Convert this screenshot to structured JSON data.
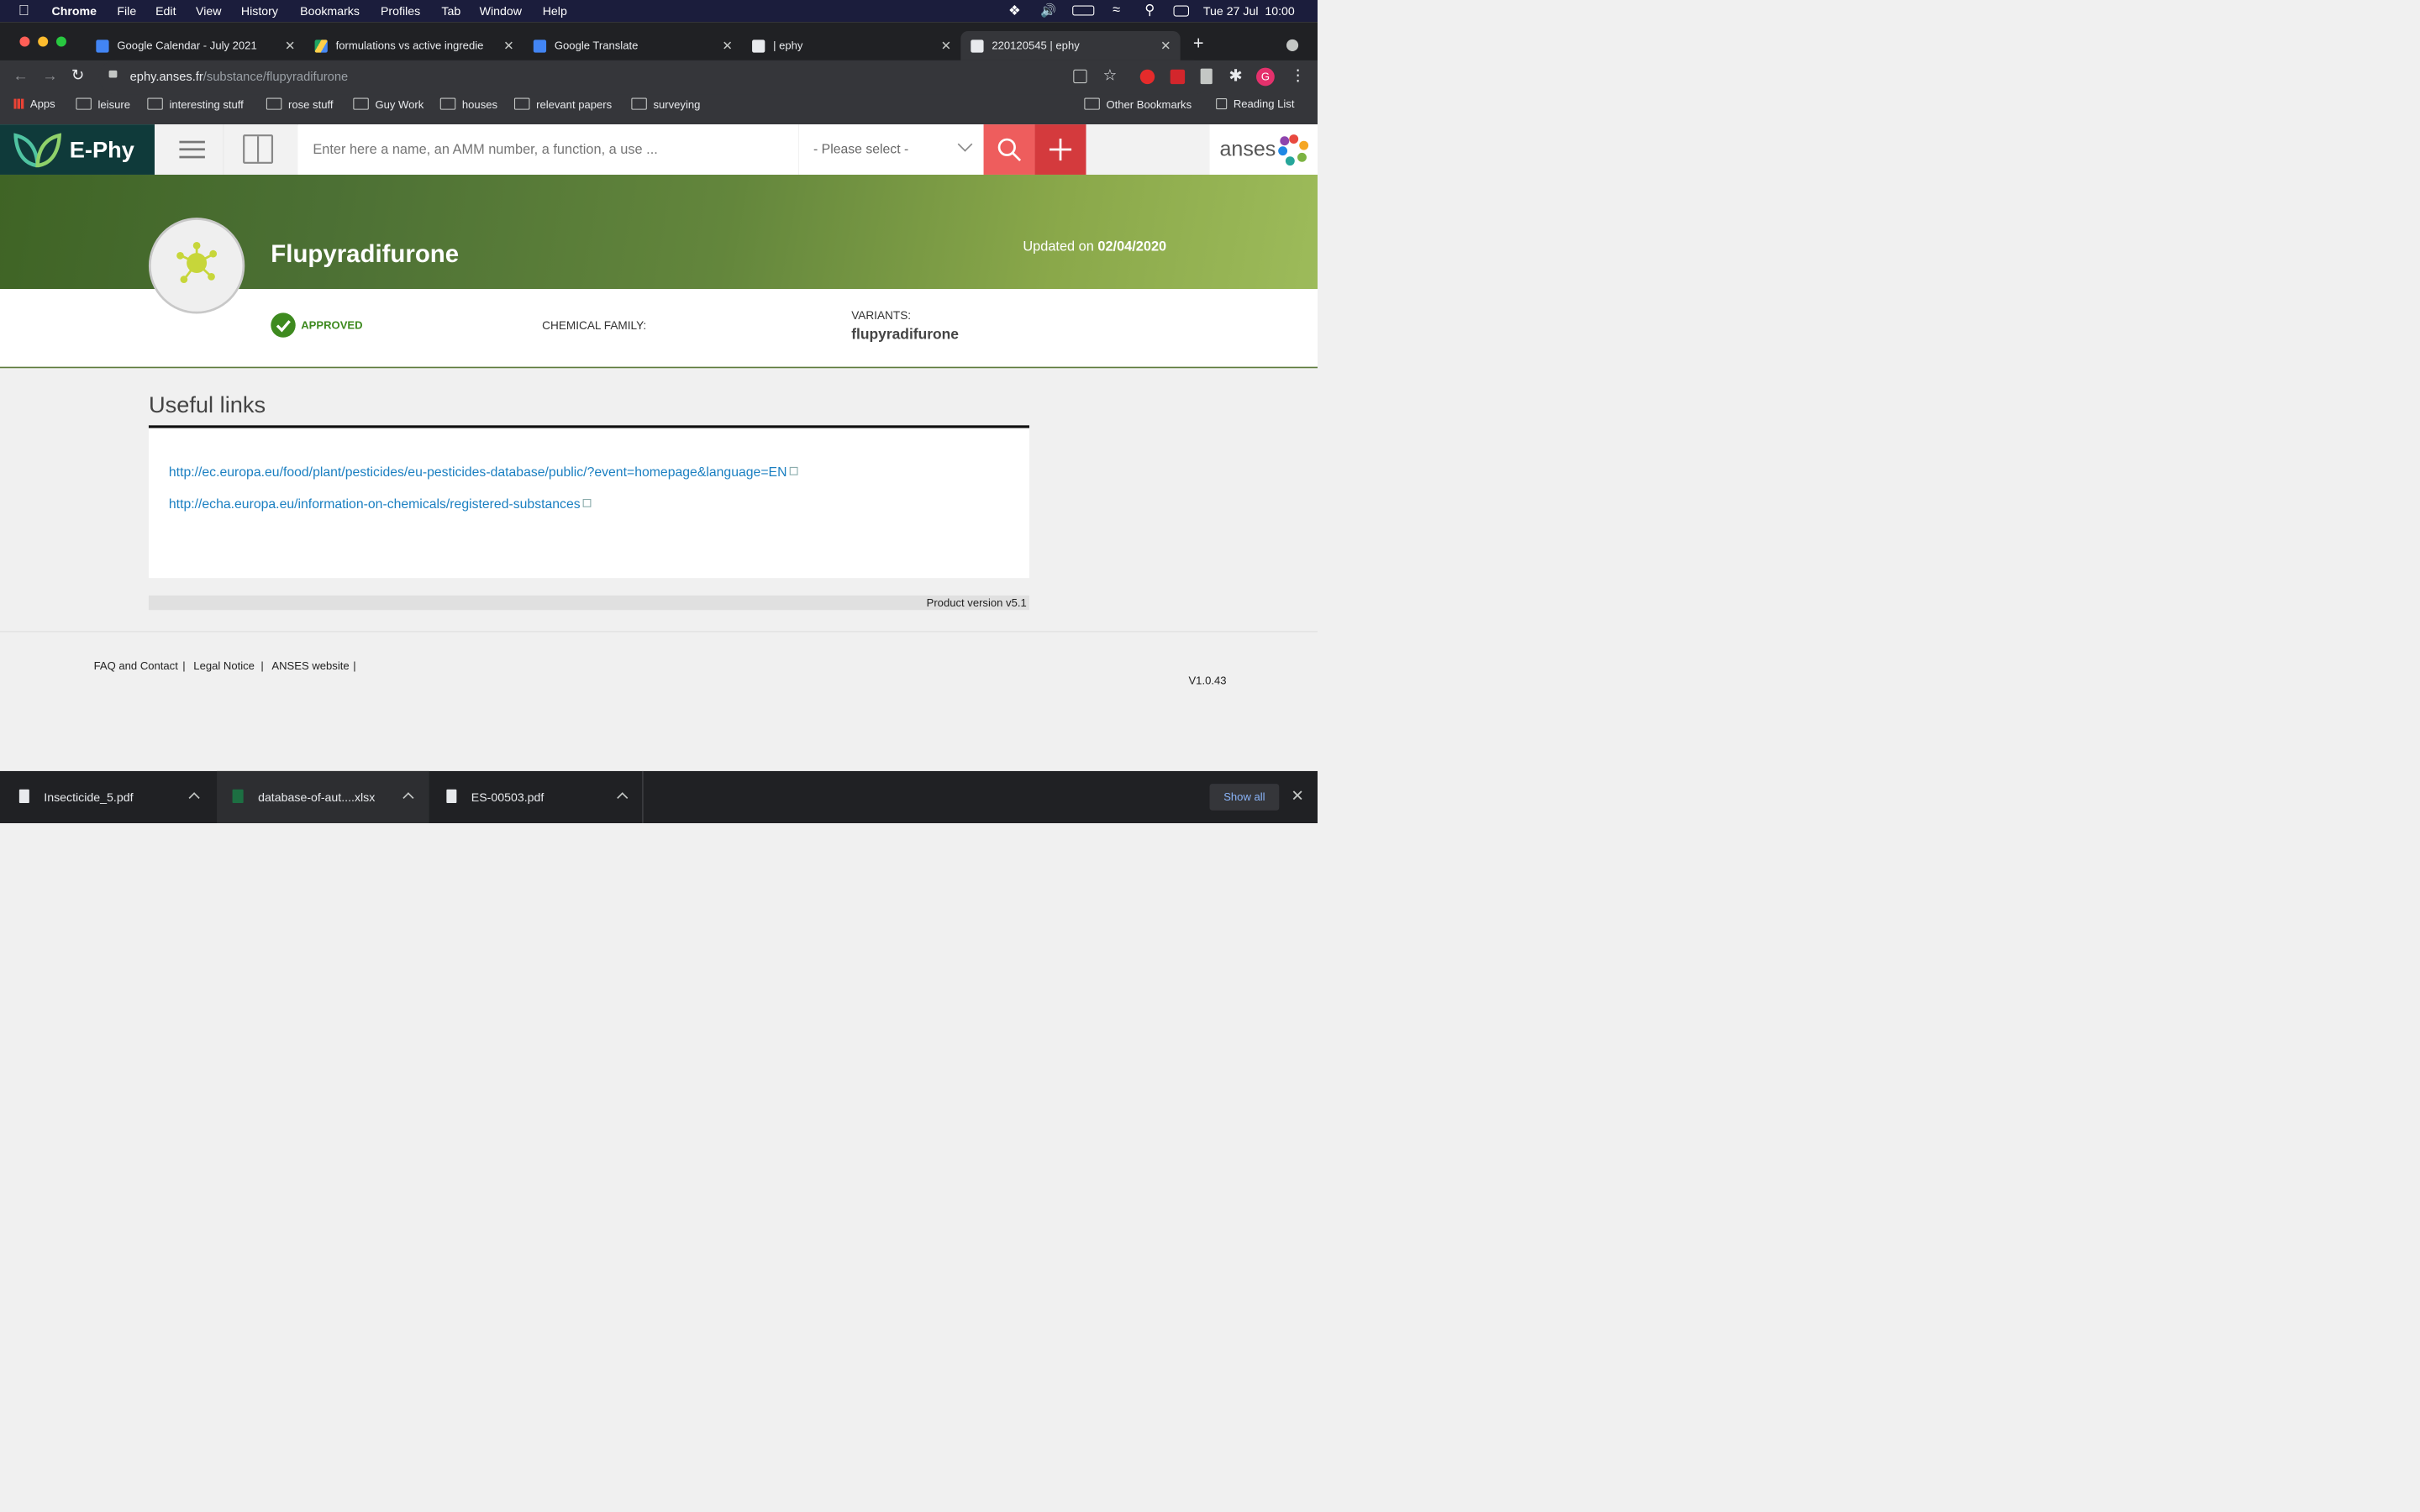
{
  "menubar": {
    "apple": "",
    "app_name": "Chrome",
    "items": [
      "File",
      "Edit",
      "View",
      "History",
      "Bookmarks",
      "Profiles",
      "Tab",
      "Window",
      "Help"
    ],
    "clock": "Tue 27 Jul  10:00"
  },
  "tabs": [
    {
      "title": "Google Calendar - July 2021",
      "favicon_label": "27"
    },
    {
      "title": "formulations vs active ingredie"
    },
    {
      "title": "Google Translate"
    },
    {
      "title": "| ephy"
    },
    {
      "title": "220120545 | ephy"
    }
  ],
  "address": {
    "domain": "ephy.anses.fr",
    "path": "/substance/flupyradifurone"
  },
  "bookmarks": {
    "apps": "Apps",
    "items": [
      "leisure",
      "interesting stuff",
      "rose stuff",
      "Guy Work",
      "houses",
      "relevant papers",
      "surveying"
    ],
    "other": "Other Bookmarks",
    "reading": "Reading List"
  },
  "profile_initial": "G",
  "site": {
    "logo_text": "E-Phy",
    "search_placeholder": "Enter here a name, an AMM number, a function, a use ...",
    "select_value": "- Please select -",
    "partner_logo": "anses"
  },
  "substance": {
    "name": "Flupyradifurone",
    "updated_label": "Updated on",
    "updated_date": "02/04/2020",
    "status": "APPROVED",
    "chemical_family_label": "CHEMICAL FAMILY:",
    "variants_label": "VARIANTS:",
    "variants_value": "flupyradifurone"
  },
  "useful_links": {
    "heading": "Useful links",
    "links": [
      "http://ec.europa.eu/food/plant/pesticides/eu-pesticides-database/public/?event=homepage&language=EN",
      "http://echa.europa.eu/information-on-chemicals/registered-substances"
    ]
  },
  "product_version": "Product version v5.1",
  "footer": {
    "links": [
      "FAQ and Contact",
      "Legal Notice",
      "ANSES website"
    ],
    "separator": "|",
    "version": "V1.0.43"
  },
  "downloads": {
    "items": [
      "Insecticide_5.pdf",
      "database-of-aut....xlsx",
      "ES-00503.pdf"
    ],
    "show_all": "Show all"
  },
  "colors": {
    "menubar": "#1b1d3c",
    "chrome_dark": "#202124",
    "ephy_nav": "#0f3a3a",
    "search_btn": "#ee5d5d",
    "add_btn": "#d43a3d",
    "approved": "#3e8a1f",
    "link": "#1a7fc1"
  },
  "icons": [
    "apple-icon",
    "wifi-icon",
    "battery-icon",
    "volume-icon",
    "search-icon",
    "star-icon",
    "reload-icon",
    "hamburger-icon",
    "book-icon",
    "chevron-down-icon",
    "plus-icon",
    "checkmark-icon",
    "molecule-icon",
    "external-link-icon",
    "pdf-file-icon",
    "excel-file-icon",
    "close-icon"
  ]
}
